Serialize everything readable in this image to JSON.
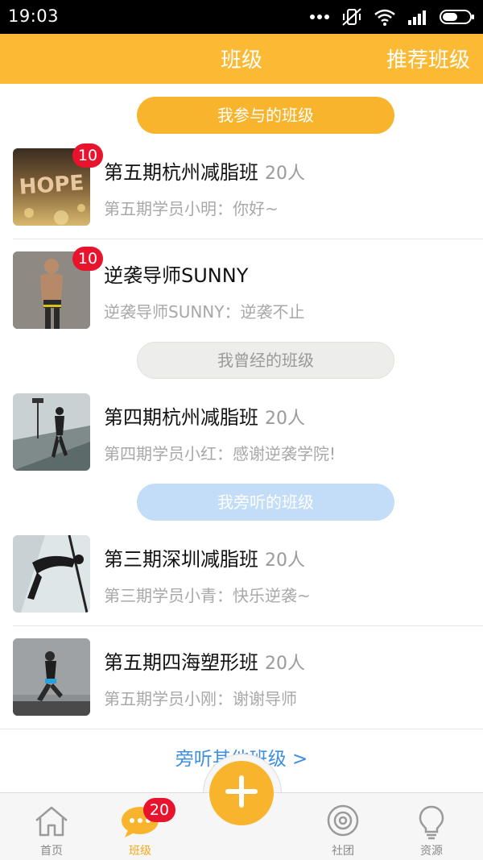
{
  "status_bar": {
    "time": "19:03"
  },
  "header": {
    "title": "班级",
    "right_action": "推荐班级"
  },
  "sections": {
    "joined": "我参与的班级",
    "past": "我曾经的班级",
    "audit": "我旁听的班级"
  },
  "classes": [
    {
      "name": "第五期杭州减脂班",
      "count": "20人",
      "message": "第五期学员小明：你好~",
      "badge": "10"
    },
    {
      "name": "逆袭导师SUNNY",
      "count": "",
      "message": "逆袭导师SUNNY：逆袭不止",
      "badge": "10"
    },
    {
      "name": "第四期杭州减脂班",
      "count": "20人",
      "message": "第四期学员小红：感谢逆袭学院!",
      "badge": ""
    },
    {
      "name": "第三期深圳减脂班",
      "count": "20人",
      "message": "第三期学员小青：快乐逆袭~",
      "badge": ""
    },
    {
      "name": "第五期四海塑形班",
      "count": "20人",
      "message": "第五期学员小刚：谢谢导师",
      "badge": ""
    }
  ],
  "more_link": "旁听其他班级 >",
  "tabbar": {
    "home": "首页",
    "classes": "班级",
    "classes_badge": "20",
    "community": "社团",
    "resources": "资源"
  },
  "colors": {
    "accent": "#fbb934",
    "badge": "#e8132d",
    "link": "#3f8fe0"
  }
}
